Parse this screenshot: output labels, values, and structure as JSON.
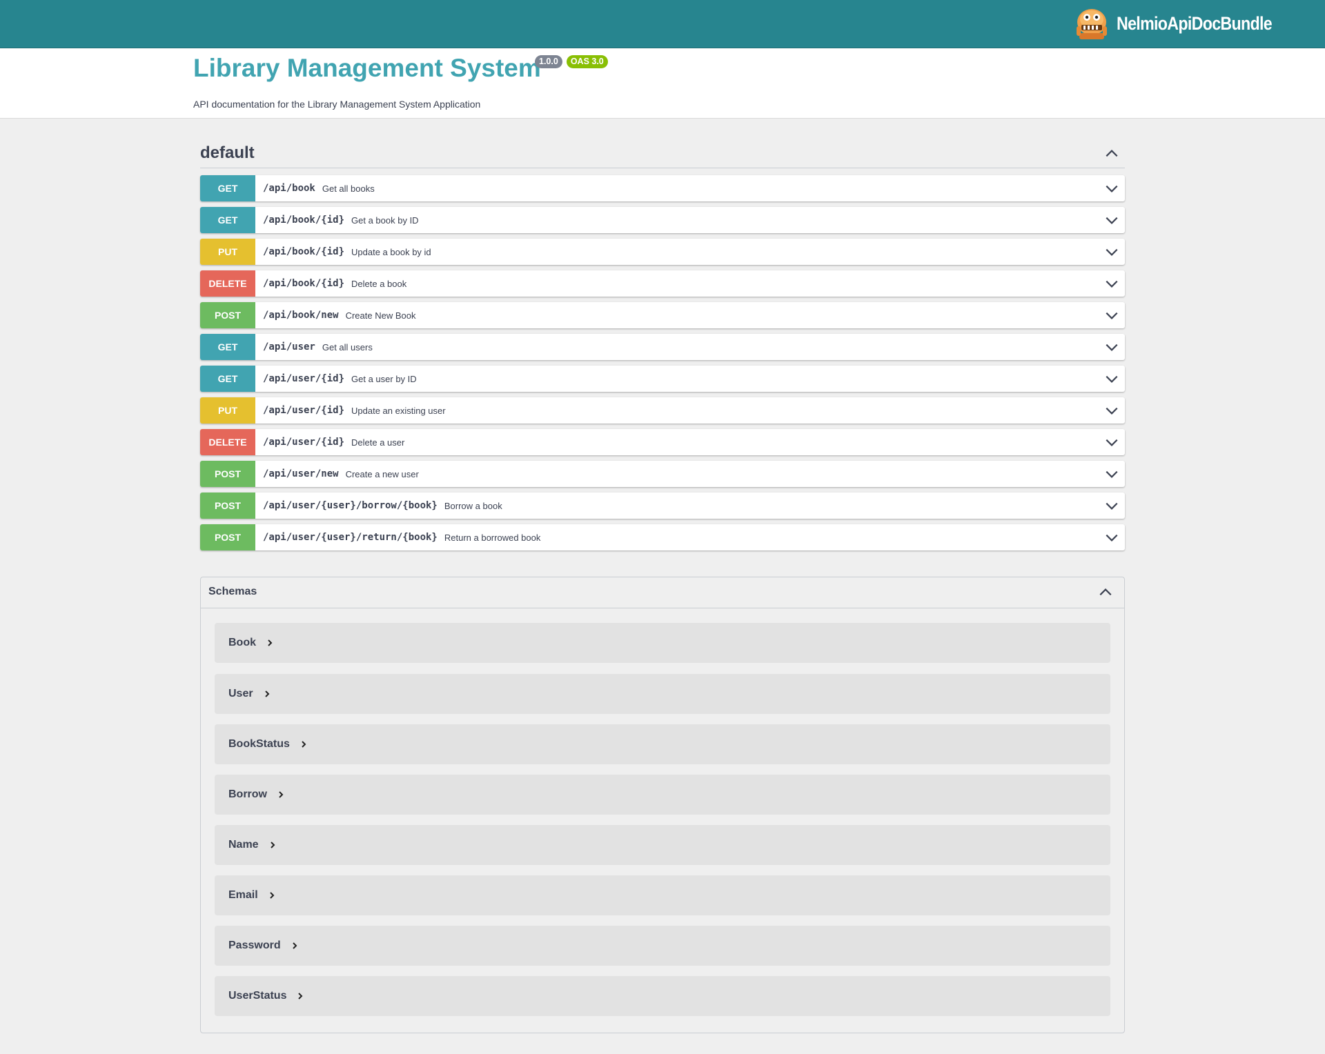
{
  "topbar": {
    "brand_text": "NelmioApiDocBundle",
    "background": "#27858f"
  },
  "info": {
    "title": "Library Management System",
    "version": "1.0.0",
    "oas": "OAS 3.0",
    "description": "API documentation for the Library Management System Application"
  },
  "section": {
    "title": "default"
  },
  "operations": [
    {
      "method": "GET",
      "path": "/api/book",
      "summary": "Get all books"
    },
    {
      "method": "GET",
      "path": "/api/book/{id}",
      "summary": "Get a book by ID"
    },
    {
      "method": "PUT",
      "path": "/api/book/{id}",
      "summary": "Update a book by id"
    },
    {
      "method": "DELETE",
      "path": "/api/book/{id}",
      "summary": "Delete a book"
    },
    {
      "method": "POST",
      "path": "/api/book/new",
      "summary": "Create New Book"
    },
    {
      "method": "GET",
      "path": "/api/user",
      "summary": "Get all users"
    },
    {
      "method": "GET",
      "path": "/api/user/{id}",
      "summary": "Get a user by ID"
    },
    {
      "method": "PUT",
      "path": "/api/user/{id}",
      "summary": "Update an existing user"
    },
    {
      "method": "DELETE",
      "path": "/api/user/{id}",
      "summary": "Delete a user"
    },
    {
      "method": "POST",
      "path": "/api/user/new",
      "summary": "Create a new user"
    },
    {
      "method": "POST",
      "path": "/api/user/{user}/borrow/{book}",
      "summary": "Borrow a book"
    },
    {
      "method": "POST",
      "path": "/api/user/{user}/return/{book}",
      "summary": "Return a borrowed book"
    }
  ],
  "schemas": {
    "title": "Schemas",
    "models": [
      "Book",
      "User",
      "BookStatus",
      "Borrow",
      "Name",
      "Email",
      "Password",
      "UserStatus"
    ]
  },
  "colors": {
    "GET": "#41a4b1",
    "PUT": "#e5c02f",
    "DELETE": "#e5675a",
    "POST": "#6dbb60",
    "title": "#41a4b1"
  }
}
